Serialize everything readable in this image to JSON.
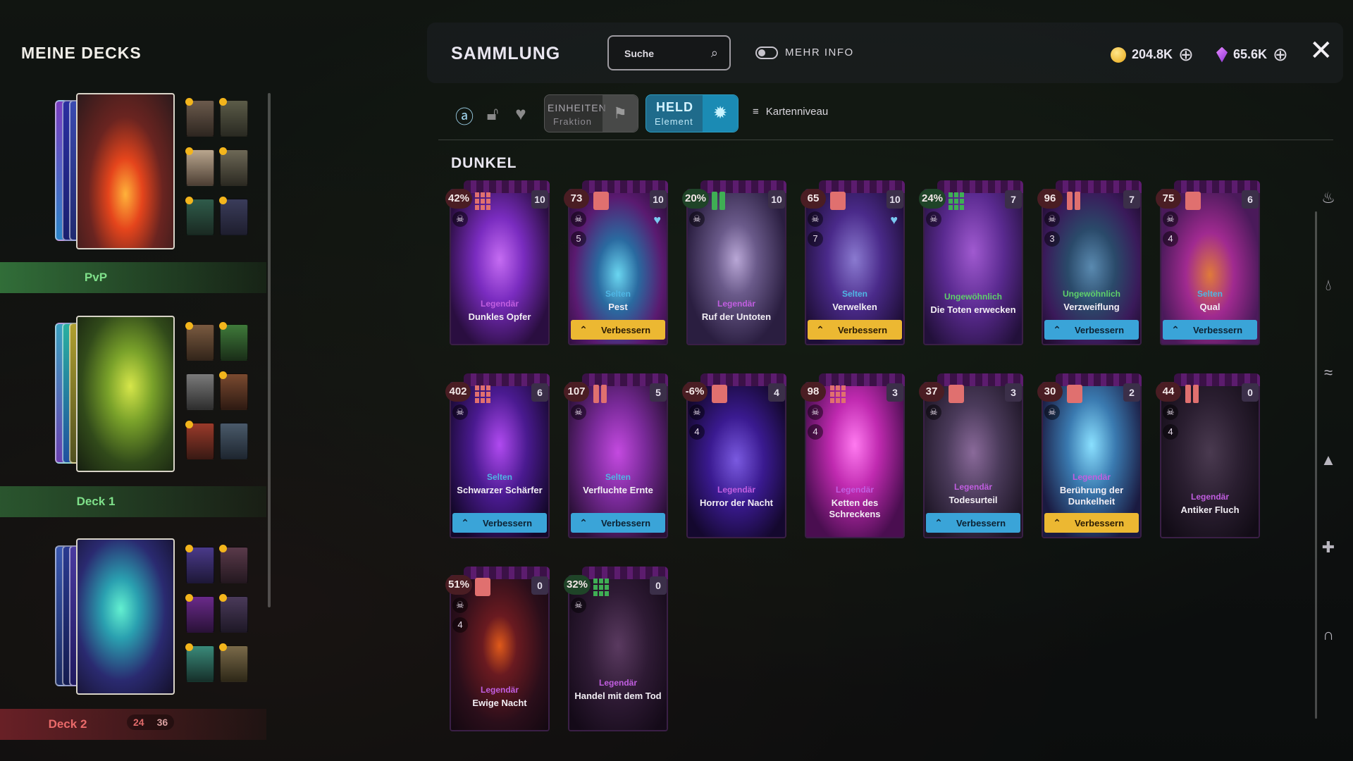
{
  "left": {
    "title": "MEINE DECKS",
    "decks": [
      {
        "name": "PvP"
      },
      {
        "name": "Deck 1"
      },
      {
        "name": "Deck 2",
        "count": "24",
        "max": "36"
      }
    ]
  },
  "header": {
    "title": "SAMMLUNG",
    "search_placeholder": "Suche",
    "more_info": "MEHR INFO",
    "gold": "204.8K",
    "gems": "65.6K"
  },
  "filters": {
    "einheiten": {
      "label": "EINHEITEN",
      "sub": "Fraktion"
    },
    "held": {
      "label": "HELD",
      "sub": "Element"
    },
    "sort_label": "Kartenniveau"
  },
  "section_title": "DUNKEL",
  "colors": {
    "upgrade_blue": "#3aa4d8",
    "upgrade_gold": "#ecb832",
    "legendary": "#c15ee0",
    "rare": "#4fb6e4",
    "uncommon": "#5fd06a"
  },
  "cards": [
    {
      "power": "42%",
      "level": "10",
      "rarity": "Legendär",
      "name": "Dunkles Opfer"
    },
    {
      "power": "73",
      "level": "10",
      "rarity": "Selten",
      "name": "Pest",
      "button": "Verbessern",
      "sub": "5"
    },
    {
      "power": "20%",
      "level": "10",
      "rarity": "Legendär",
      "name": "Ruf der Untoten"
    },
    {
      "power": "65",
      "level": "10",
      "rarity": "Selten",
      "name": "Verwelken",
      "button": "Verbessern",
      "sub": "7"
    },
    {
      "power": "24%",
      "level": "7",
      "rarity": "Ungewöhnlich",
      "name": "Die Toten erwecken"
    },
    {
      "power": "96",
      "level": "7",
      "rarity": "Ungewöhnlich",
      "name": "Verzweiflung",
      "button": "Verbessern",
      "sub": "3"
    },
    {
      "power": "75",
      "level": "6",
      "rarity": "Selten",
      "name": "Qual",
      "button": "Verbessern",
      "sub": "4"
    },
    {
      "power": "402",
      "level": "6",
      "rarity": "Selten",
      "name": "Schwarzer Schärfer",
      "button": "Verbessern"
    },
    {
      "power": "107",
      "level": "5",
      "rarity": "Selten",
      "name": "Verfluchte Ernte",
      "button": "Verbessern"
    },
    {
      "power": "-6%",
      "level": "4",
      "rarity": "Legendär",
      "name": "Horror der Nacht",
      "sub": "4"
    },
    {
      "power": "98",
      "level": "3",
      "rarity": "Legendär",
      "name": "Ketten des Schreckens",
      "sub": "4"
    },
    {
      "power": "37",
      "level": "3",
      "rarity": "Legendär",
      "name": "Todesurteil",
      "button": "Verbessern"
    },
    {
      "power": "30",
      "level": "2",
      "rarity": "Legendär",
      "name": "Berührung der Dunkelheit",
      "button": "Verbessern"
    },
    {
      "power": "44",
      "level": "0",
      "rarity": "Legendär",
      "name": "Antiker Fluch",
      "sub": "4"
    },
    {
      "power": "51%",
      "level": "0",
      "rarity": "Legendär",
      "name": "Ewige Nacht",
      "sub": "4"
    },
    {
      "power": "32%",
      "level": "0",
      "rarity": "Legendär",
      "name": "Handel mit dem Tod"
    }
  ]
}
